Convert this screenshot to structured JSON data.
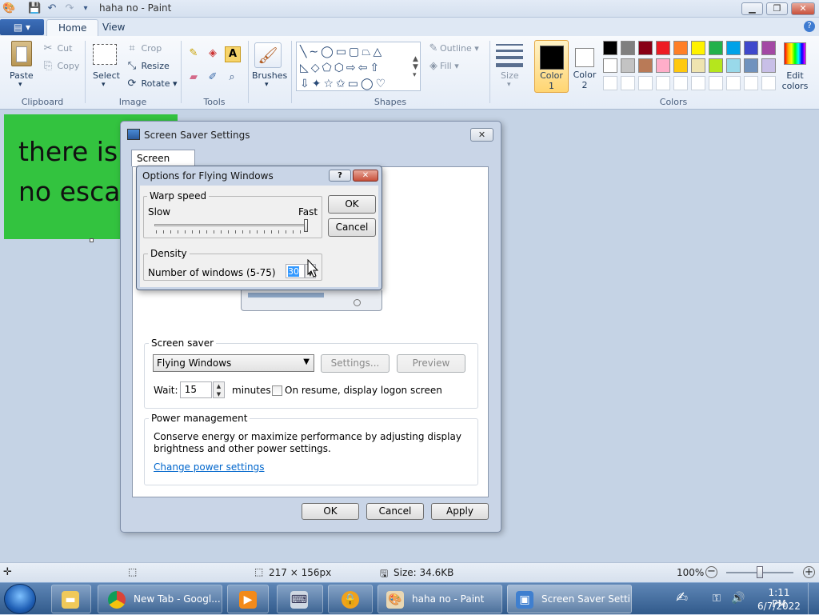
{
  "window": {
    "title": "haha no - Paint"
  },
  "menu": {
    "file": "▤ ▾",
    "tabs": [
      "Home",
      "View"
    ],
    "help": "?"
  },
  "ribbon": {
    "clipboard": {
      "label": "Clipboard",
      "paste": "Paste",
      "cut": "Cut",
      "copy": "Copy"
    },
    "image": {
      "label": "Image",
      "select": "Select",
      "crop": "Crop",
      "resize": "Resize",
      "rotate": "Rotate"
    },
    "tools": {
      "label": "Tools"
    },
    "brushes": {
      "label": "Brushes"
    },
    "shapes": {
      "label": "Shapes",
      "outline": "Outline",
      "fill": "Fill"
    },
    "size": {
      "label": "Size"
    },
    "color1": {
      "line1": "Color",
      "line2": "1"
    },
    "color2": {
      "line1": "Color",
      "line2": "2"
    },
    "colors": {
      "label": "Colors",
      "edit_line1": "Edit",
      "edit_line2": "colors",
      "palette_row1": [
        "#000000",
        "#7f7f7f",
        "#880015",
        "#ed1c24",
        "#ff7f27",
        "#fff200",
        "#22b14c",
        "#00a2e8",
        "#3f48cc",
        "#a349a4"
      ],
      "palette_row2": [
        "#ffffff",
        "#c3c3c3",
        "#b97a57",
        "#ffaec9",
        "#ffc90e",
        "#efe4b0",
        "#b5e61d",
        "#99d9ea",
        "#7092be",
        "#c8bfe7"
      ]
    }
  },
  "canvas": {
    "line1": "there is",
    "line2": "no escap"
  },
  "screensaver_dialog": {
    "title": "Screen Saver Settings",
    "tab": "Screen Saver",
    "screensaver_group": "Screen saver",
    "selected": "Flying Windows",
    "settings": "Settings...",
    "preview": "Preview",
    "wait_label": "Wait:",
    "wait_value": "15",
    "minutes": "minutes",
    "resume_label": "On resume, display logon screen",
    "power_group": "Power management",
    "power_text1": "Conserve energy or maximize performance by adjusting display",
    "power_text2": "brightness and other power settings.",
    "power_link": "Change power settings",
    "ok": "OK",
    "cancel": "Cancel",
    "apply": "Apply"
  },
  "flying_windows_dialog": {
    "title": "Options for Flying Windows",
    "warp_group": "Warp speed",
    "slow": "Slow",
    "fast": "Fast",
    "density_group": "Density",
    "windows_label": "Number of windows (5-75)",
    "windows_value": "30",
    "ok": "OK",
    "cancel": "Cancel"
  },
  "statusbar": {
    "dimensions": "217 × 156px",
    "size": "Size: 34.6KB",
    "zoom": "100%"
  },
  "taskbar": {
    "chrome": "New Tab - Googl...",
    "paint": "haha no - Paint",
    "screensaver": "Screen Saver Setti...",
    "time": "1:11 PM",
    "date": "6/7/2022"
  }
}
